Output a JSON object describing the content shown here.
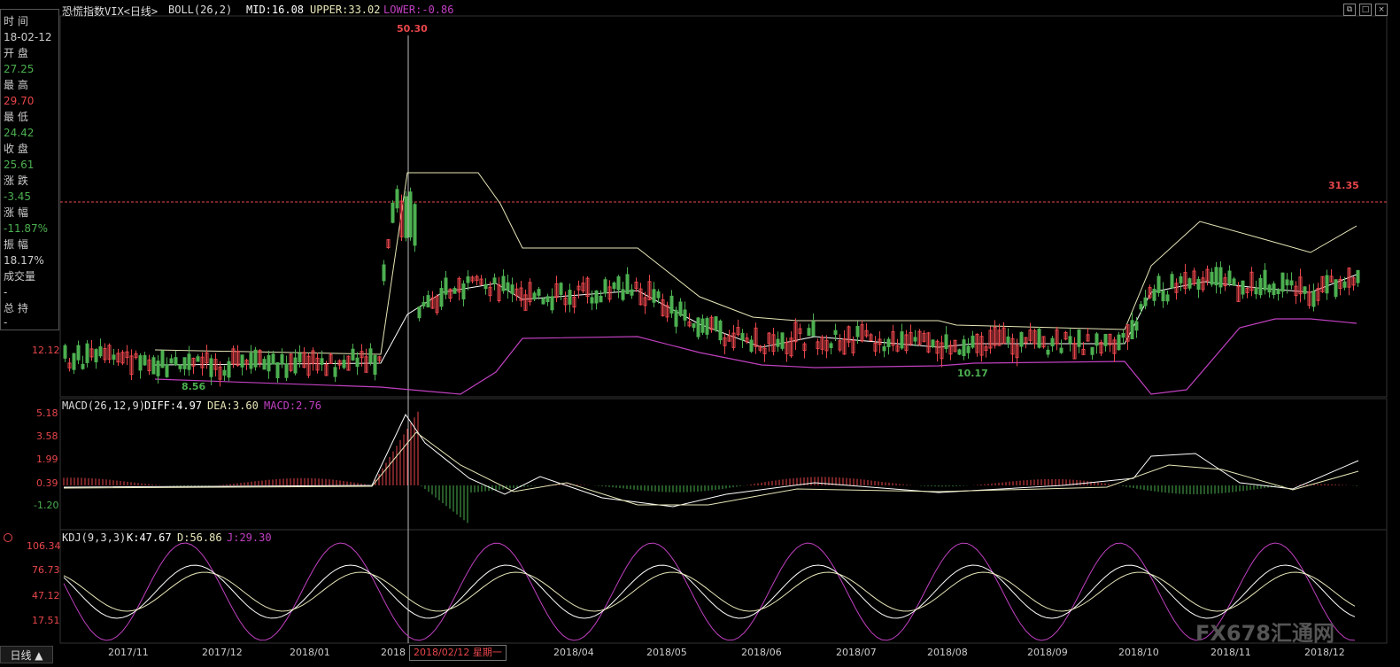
{
  "header": {
    "title": "恐慌指数VIX<日线>",
    "boll": "BOLL(26,2)",
    "boll_mid": "MID:16.08",
    "boll_upper": "UPPER:33.02",
    "boll_lower": "LOWER:-0.86"
  },
  "info_panel": {
    "time_label": "时 间",
    "time_value": "18-02-12",
    "open_label": "开 盘",
    "open_value": "27.25",
    "high_label": "最 高",
    "high_value": "29.70",
    "low_label": "最 低",
    "low_value": "24.42",
    "close_label": "收 盘",
    "close_value": "25.61",
    "change_label": "涨 跌",
    "change_value": "-3.45",
    "pct_label": "涨 幅",
    "pct_value": "-11.87%",
    "amp_label": "振 幅",
    "amp_value": "18.17%",
    "vol_label": "成交量",
    "vol_value": "-",
    "hold_label": "总 持",
    "hold_value": "-"
  },
  "main_chart": {
    "price_axis_label": "12.12",
    "annot_high": "50.30",
    "annot_low": "8.56",
    "annot_low2": "10.17",
    "annot_last": "31.35"
  },
  "macd": {
    "header": "MACD(26,12,9)",
    "diff": "DIFF:4.97",
    "dea": "DEA:3.60",
    "macd": "MACD:2.76",
    "axis": [
      "5.18",
      "3.58",
      "1.99",
      "0.39",
      "-1.20"
    ]
  },
  "kdj": {
    "header": "KDJ(9,3,3)",
    "k": "K:47.67",
    "d": "D:56.86",
    "j": "J:29.30",
    "axis": [
      "106.34",
      "76.73",
      "47.12",
      "17.51"
    ]
  },
  "x_axis": {
    "labels": [
      "2017/11",
      "2017/12",
      "2018/01",
      "2018",
      "2018/04",
      "2018/05",
      "2018/06",
      "2018/07",
      "2018/08",
      "2018/09",
      "2018/10",
      "2018/11",
      "2018/12"
    ],
    "cursor_label": "2018/02/12 星期一"
  },
  "tabs": {
    "period": "日线 ▲"
  },
  "watermark": "FX678汇通网",
  "colors": {
    "up": "#e8464b",
    "down": "#4caf50",
    "boll_upper": "#e8e6b8",
    "boll_mid": "#ffffff",
    "boll_lower": "#c040c0",
    "dash_line": "#e8464b"
  }
}
